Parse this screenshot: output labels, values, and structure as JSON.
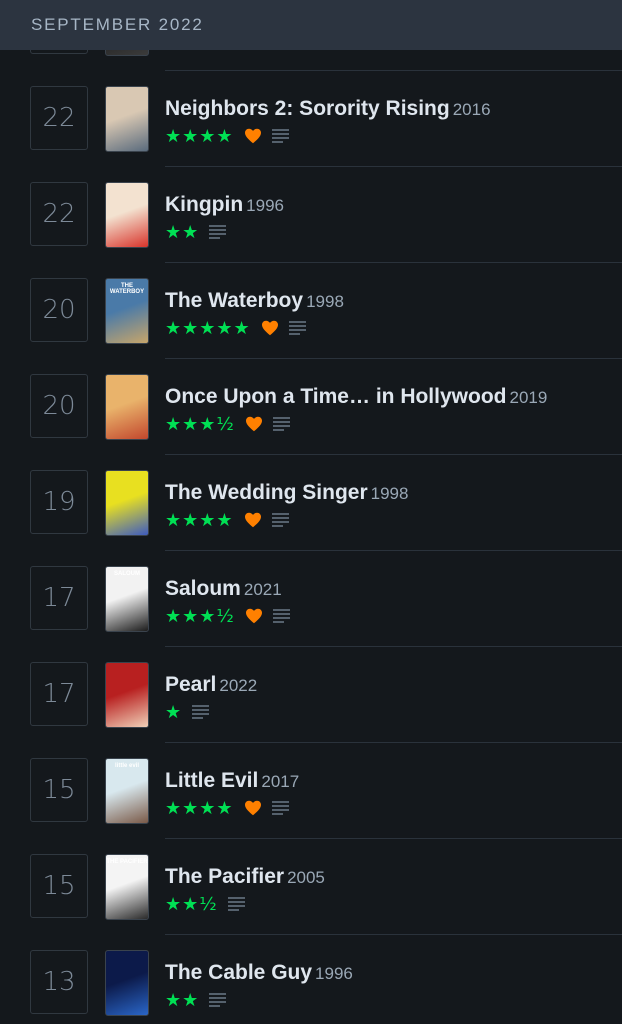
{
  "header": {
    "month": "SEPTEMBER 2022"
  },
  "colors": {
    "background": "#14181c",
    "header_bg": "#2c3440",
    "star": "#00e054",
    "heart": "#ff8000",
    "text": "#dfe6ee",
    "muted": "#9aa8b6"
  },
  "entries": [
    {
      "day": "",
      "title": "",
      "year": "",
      "stars": "",
      "liked": false,
      "review": false,
      "poster_text": "",
      "poster_colors": [
        "#1e1e1e",
        "#3b3b3b"
      ]
    },
    {
      "day": "22",
      "title": "Neighbors 2: Sorority Rising",
      "year": "2016",
      "stars": "★★★★",
      "liked": true,
      "review": true,
      "poster_text": "",
      "poster_colors": [
        "#d9c8b3",
        "#5a6b7d"
      ]
    },
    {
      "day": "22",
      "title": "Kingpin",
      "year": "1996",
      "stars": "★★",
      "liked": false,
      "review": true,
      "poster_text": "",
      "poster_colors": [
        "#f3e2d0",
        "#d8342b"
      ]
    },
    {
      "day": "20",
      "title": "The Waterboy",
      "year": "1998",
      "stars": "★★★★★",
      "liked": true,
      "review": true,
      "poster_text": "THE WATERBOY",
      "poster_colors": [
        "#4a7aa8",
        "#c7a56a"
      ]
    },
    {
      "day": "20",
      "title": "Once Upon a Time… in Hollywood",
      "year": "2019",
      "stars": "★★★½",
      "liked": true,
      "review": true,
      "poster_text": "",
      "poster_colors": [
        "#e9b36b",
        "#c2472d"
      ]
    },
    {
      "day": "19",
      "title": "The Wedding Singer",
      "year": "1998",
      "stars": "★★★★",
      "liked": true,
      "review": true,
      "poster_text": "",
      "poster_colors": [
        "#e8e020",
        "#3e5cc0"
      ]
    },
    {
      "day": "17",
      "title": "Saloum",
      "year": "2021",
      "stars": "★★★½",
      "liked": true,
      "review": true,
      "poster_text": "SALOUM",
      "poster_colors": [
        "#f2f2f2",
        "#1c1c1c"
      ]
    },
    {
      "day": "17",
      "title": "Pearl",
      "year": "2022",
      "stars": "★",
      "liked": false,
      "review": true,
      "poster_text": "",
      "poster_colors": [
        "#b82020",
        "#f0d0b8"
      ]
    },
    {
      "day": "15",
      "title": "Little Evil",
      "year": "2017",
      "stars": "★★★★",
      "liked": true,
      "review": true,
      "poster_text": "little evil",
      "poster_colors": [
        "#d8e8ee",
        "#7a5a48"
      ]
    },
    {
      "day": "15",
      "title": "The Pacifier",
      "year": "2005",
      "stars": "★★½",
      "liked": false,
      "review": true,
      "poster_text": "THE PACIFIER",
      "poster_colors": [
        "#f4f4f4",
        "#2a2a2a"
      ]
    },
    {
      "day": "13",
      "title": "The Cable Guy",
      "year": "1996",
      "stars": "★★",
      "liked": false,
      "review": true,
      "poster_text": "",
      "poster_colors": [
        "#0c1a4a",
        "#2a66c8"
      ]
    }
  ]
}
